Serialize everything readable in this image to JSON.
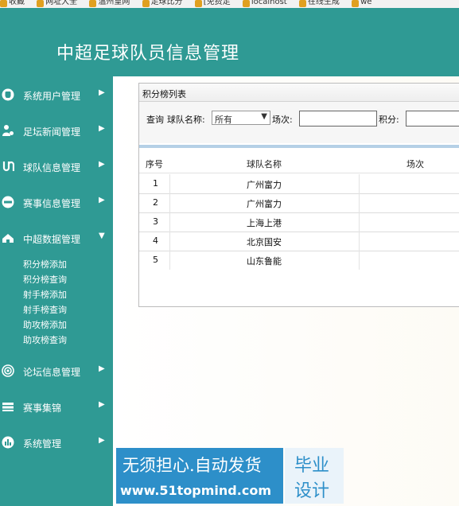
{
  "bookmarks": [
    {
      "label": "收藏"
    },
    {
      "label": "网址大全"
    },
    {
      "label": "温州皇网"
    },
    {
      "label": "足球比分"
    },
    {
      "label": "[免费足"
    },
    {
      "label": "localhost"
    },
    {
      "label": "在线生成"
    },
    {
      "label": "we"
    }
  ],
  "header": {
    "title": "中超足球队员信息管理"
  },
  "sidebar": {
    "items": [
      {
        "label": "系统用户管理",
        "icon": "user-icon",
        "arrow": "▶"
      },
      {
        "label": "足坛新闻管理",
        "icon": "people-icon",
        "arrow": "▶"
      },
      {
        "label": "球队信息管理",
        "icon": "link-icon",
        "arrow": "▶"
      },
      {
        "label": "赛事信息管理",
        "icon": "app-icon",
        "arrow": "▶"
      },
      {
        "label": "中超数据管理",
        "icon": "cloud-icon",
        "arrow": "▼"
      },
      {
        "label": "论坛信息管理",
        "icon": "target-icon",
        "arrow": "▶"
      },
      {
        "label": "赛事集锦",
        "icon": "stack-icon",
        "arrow": "▶"
      },
      {
        "label": "系统管理",
        "icon": "chart-icon",
        "arrow": "▶"
      }
    ],
    "submenu": [
      "积分榜添加",
      "积分榜查询",
      "射手榜添加",
      "射手榜查询",
      "助攻榜添加",
      "助攻榜查询"
    ]
  },
  "panel": {
    "title": "积分榜列表",
    "search": {
      "query_label": "查询",
      "team_label": "球队名称:",
      "team_value": "所有",
      "matches_label": "场次:",
      "matches_value": "",
      "points_label": "积分:",
      "points_value": ""
    },
    "table": {
      "headers": [
        "序号",
        "球队名称",
        "场次"
      ],
      "rows": [
        {
          "no": "1",
          "team": "广州富力"
        },
        {
          "no": "2",
          "team": "广州富力"
        },
        {
          "no": "3",
          "team": "上海上港"
        },
        {
          "no": "4",
          "team": "北京国安"
        },
        {
          "no": "5",
          "team": "山东鲁能"
        }
      ]
    }
  },
  "watermark": {
    "line1": "无须担心.自动发货",
    "line2": "www.51topmind.com",
    "right1": "毕业",
    "right2": "设计"
  },
  "colors": {
    "theme": "#2f9a94",
    "watermark_blue": "#2d8fc9"
  }
}
